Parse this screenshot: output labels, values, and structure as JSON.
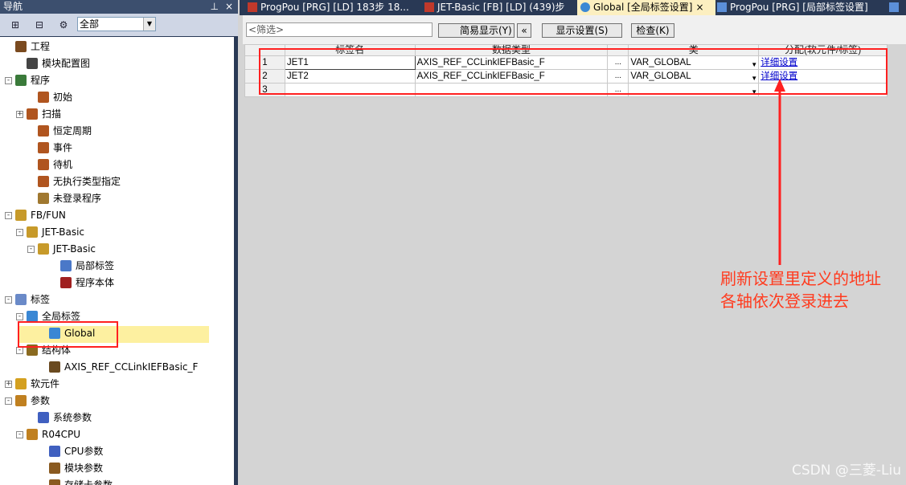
{
  "navigation": {
    "title": "导航",
    "filter_value": "全部",
    "tree": [
      {
        "label": "工程",
        "icon": "project-icon",
        "expander": ""
      },
      {
        "label": "模块配置图",
        "icon": "module-config-icon",
        "expander": ""
      },
      {
        "label": "程序",
        "icon": "program-folder-icon",
        "expander": "-"
      },
      {
        "label": "初始",
        "icon": "program-type-icon",
        "expander": ""
      },
      {
        "label": "扫描",
        "icon": "program-type-icon",
        "expander": "+"
      },
      {
        "label": "恒定周期",
        "icon": "program-type-icon",
        "expander": ""
      },
      {
        "label": "事件",
        "icon": "program-type-icon",
        "expander": ""
      },
      {
        "label": "待机",
        "icon": "program-type-icon",
        "expander": ""
      },
      {
        "label": "无执行类型指定",
        "icon": "program-type-icon",
        "expander": ""
      },
      {
        "label": "未登录程序",
        "icon": "unregistered-program-icon",
        "expander": ""
      },
      {
        "label": "FB/FUN",
        "icon": "fb-folder-icon",
        "expander": "-"
      },
      {
        "label": "JET-Basic",
        "icon": "folder-icon",
        "expander": "-"
      },
      {
        "label": "JET-Basic",
        "icon": "fb-icon",
        "expander": "-"
      },
      {
        "label": "局部标签",
        "icon": "local-label-icon",
        "expander": ""
      },
      {
        "label": "程序本体",
        "icon": "program-body-icon",
        "expander": ""
      },
      {
        "label": "标签",
        "icon": "label-folder-icon",
        "expander": "-"
      },
      {
        "label": "全局标签",
        "icon": "global-label-folder-icon",
        "expander": "-"
      },
      {
        "label": "Global",
        "icon": "global-icon",
        "expander": ""
      },
      {
        "label": "结构体",
        "icon": "struct-folder-icon",
        "expander": "-"
      },
      {
        "label": "AXIS_REF_CCLinkIEFBasic_F",
        "icon": "struct-icon",
        "expander": ""
      },
      {
        "label": "软元件",
        "icon": "device-folder-icon",
        "expander": "+"
      },
      {
        "label": "参数",
        "icon": "parameter-folder-icon",
        "expander": "-"
      },
      {
        "label": "系统参数",
        "icon": "system-parameter-icon",
        "expander": ""
      },
      {
        "label": "R04CPU",
        "icon": "cpu-folder-icon",
        "expander": "-"
      },
      {
        "label": "CPU参数",
        "icon": "cpu-parameter-icon",
        "expander": ""
      },
      {
        "label": "模块参数",
        "icon": "module-parameter-icon",
        "expander": ""
      },
      {
        "label": "存储卡参数",
        "icon": "memory-card-parameter-icon",
        "expander": ""
      }
    ]
  },
  "tabs": [
    {
      "label": "ProgPou [PRG] [LD] 183步 18..."
    },
    {
      "label": "JET-Basic [FB] [LD] (439)步"
    },
    {
      "label": "Global [全局标签设置]",
      "close": "×"
    },
    {
      "label": "ProgPou [PRG] [局部标签设置]"
    }
  ],
  "toolbar": {
    "filter_placeholder": "<筛选>",
    "simple_display": "简易显示(Y)",
    "collapse_glyph": "«",
    "display_settings": "显示设置(S)",
    "check": "检查(K)"
  },
  "table": {
    "columns": [
      "标签名",
      "数据类型",
      "",
      "类",
      "分配(软元件/标签)"
    ],
    "rows": [
      {
        "no": "1",
        "name": "JET1",
        "type": "AXIS_REF_CCLinkIEFBasic_F",
        "dots": "...",
        "class": "VAR_GLOBAL",
        "assign": "详细设置"
      },
      {
        "no": "2",
        "name": "JET2",
        "type": "AXIS_REF_CCLinkIEFBasic_F",
        "dots": "...",
        "class": "VAR_GLOBAL",
        "assign": "详细设置"
      },
      {
        "no": "3",
        "name": "",
        "type": "",
        "dots": "...",
        "class": "",
        "assign": ""
      }
    ]
  },
  "annotation": {
    "line1": "刷新设置里定义的地址",
    "line2": "各轴依次登录进去"
  },
  "watermark": "CSDN @三菱-Liu",
  "colors": {
    "annotation_red": "#ff2020",
    "nav_background": "#293955",
    "selected_tab": "#fcefc0",
    "highlight": "#fdf0a0"
  }
}
